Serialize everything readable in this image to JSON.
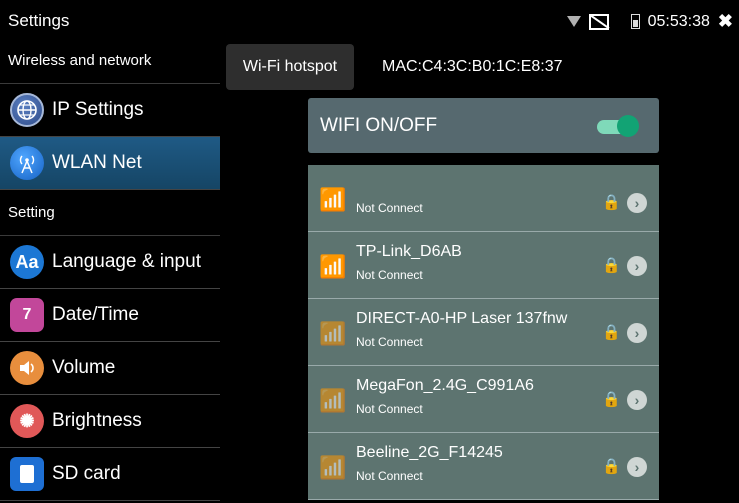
{
  "statusbar": {
    "title": "Settings",
    "time": "05:53:38",
    "icons": [
      "wifi-signal-icon",
      "no-sim-icon",
      "battery-icon",
      "close-icon"
    ],
    "close_glyph": "✖"
  },
  "sidebar": {
    "section_wireless": "Wireless and network",
    "section_setting": "Setting",
    "items": [
      {
        "label": "IP Settings",
        "icon": "globe-icon",
        "glyph": "🌐"
      },
      {
        "label": "WLAN Net",
        "icon": "antenna-icon",
        "glyph": "((•))"
      },
      {
        "label": "Language & input",
        "icon": "language-icon",
        "glyph": "Aa"
      },
      {
        "label": "Date/Time",
        "icon": "calendar-icon",
        "glyph": "7"
      },
      {
        "label": "Volume",
        "icon": "speaker-icon",
        "glyph": "🔊"
      },
      {
        "label": "Brightness",
        "icon": "brightness-icon",
        "glyph": "✺"
      },
      {
        "label": "SD card",
        "icon": "sdcard-icon",
        "glyph": ""
      }
    ],
    "active_index": 1
  },
  "main": {
    "hotspot_tab": "Wi-Fi hotspot",
    "mac": "MAC:C4:3C:B0:1C:E8:37",
    "wifi_toggle_label": "WIFI ON/OFF",
    "wifi_enabled": true,
    "networks": [
      {
        "name": "",
        "status": "Not Connect",
        "signal": "strong"
      },
      {
        "name": "TP-Link_D6AB",
        "status": "Not Connect",
        "signal": "strong"
      },
      {
        "name": "DIRECT-A0-HP Laser 137fnw",
        "status": "Not Connect",
        "signal": "weak"
      },
      {
        "name": "MegaFon_2.4G_C991A6",
        "status": "Not Connect",
        "signal": "weak"
      },
      {
        "name": "Beeline_2G_F14245",
        "status": "Not Connect",
        "signal": "weak"
      }
    ]
  },
  "colors": {
    "active_item": "#1f5a85",
    "toggle_panel": "#56696f",
    "network_row": "#5d7470",
    "toggle_on": "#12a374"
  }
}
